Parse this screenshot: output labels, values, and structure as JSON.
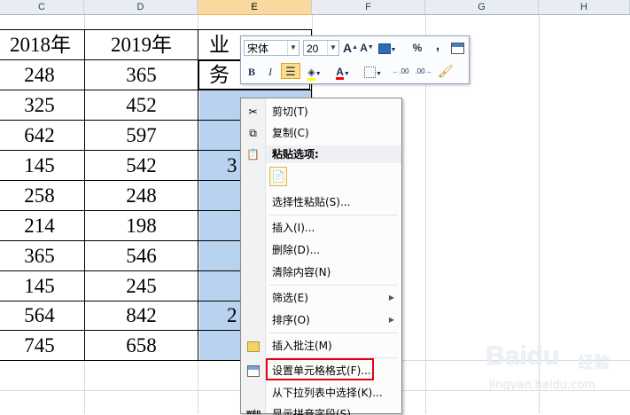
{
  "columns": [
    "C",
    "D",
    "E",
    "F",
    "G",
    "H"
  ],
  "header_row": [
    "2018年",
    "2019年",
    "业务"
  ],
  "rows": [
    [
      "248",
      "365"
    ],
    [
      "325",
      "452"
    ],
    [
      "642",
      "597"
    ],
    [
      "145",
      "542"
    ],
    [
      "258",
      "248"
    ],
    [
      "214",
      "198"
    ],
    [
      "365",
      "546"
    ],
    [
      "145",
      "245"
    ],
    [
      "564",
      "842"
    ],
    [
      "745",
      "658"
    ]
  ],
  "e_column_fragments": [
    "3",
    "2"
  ],
  "mini_toolbar": {
    "font_name": "宋体",
    "font_size": "20",
    "grow_font": "A",
    "shrink_font": "A",
    "percent": "%",
    "comma": ",",
    "bold": "B",
    "italic": "I",
    "font_color_label": "A",
    "inc_decimal": ".00",
    "dec_decimal": ".00"
  },
  "context_menu": {
    "cut": "剪切(T)",
    "copy": "复制(C)",
    "paste_options": "粘贴选项:",
    "paste_special": "选择性粘贴(S)...",
    "insert": "插入(I)...",
    "delete": "删除(D)...",
    "clear": "清除内容(N)",
    "filter": "筛选(E)",
    "sort": "排序(O)",
    "insert_comment": "插入批注(M)",
    "format_cells": "设置单元格格式(F)...",
    "pick_list": "从下拉列表中选择(K)...",
    "phonetic": "显示拼音字段(S)"
  },
  "watermark": {
    "logo": "Baidu",
    "sub": "经验",
    "url": "jingyan.baidu.com"
  },
  "colors": {
    "accent_red": "#e60012",
    "selection": "#b8d2ef",
    "selected_header": "#f9d99f"
  }
}
